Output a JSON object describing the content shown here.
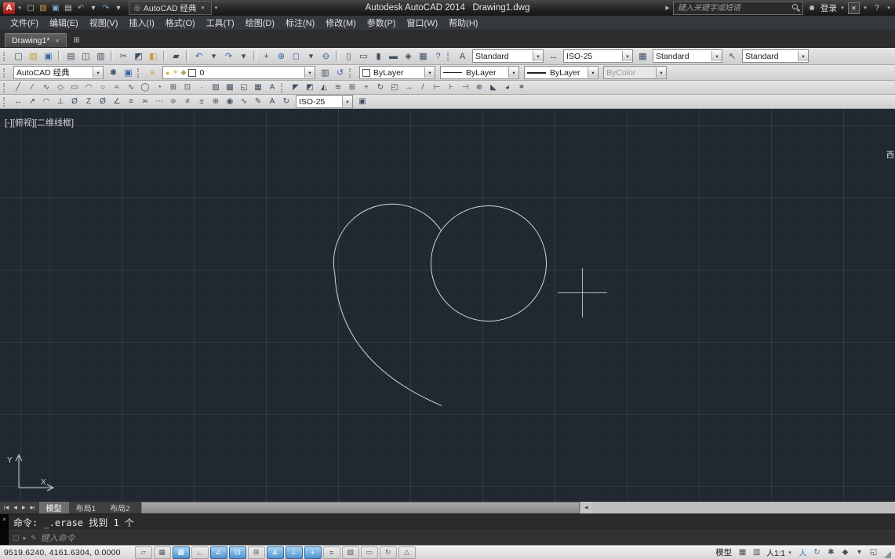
{
  "glyphs": {
    "caret": "▾",
    "play": "▶",
    "person": "☻",
    "exchange": "✕",
    "question": "?",
    "close": "×"
  },
  "colors": {
    "canvas_background": "#212830",
    "drawing_line": "#d6d9dc",
    "toggle_on_blue": "#4e93cf",
    "logo_red": "#9c150f"
  },
  "titlebar": {
    "logo_letter": "A",
    "qat": [
      {
        "name": "qat-new-icon",
        "glyph": "▢"
      },
      {
        "name": "qat-open-icon",
        "glyph": "▧",
        "color": "#c89a3c"
      },
      {
        "name": "qat-save-icon",
        "glyph": "▣",
        "color": "#7fa8d8"
      },
      {
        "name": "qat-plot-icon",
        "glyph": "▤"
      },
      {
        "name": "qat-undo-icon",
        "glyph": "↶",
        "color": "#7fa8d8"
      },
      {
        "name": "qat-undo-dropdown-icon",
        "glyph": "▾"
      },
      {
        "name": "qat-redo-icon",
        "glyph": "↷",
        "color": "#7fa8d8"
      },
      {
        "name": "qat-redo-dropdown-icon",
        "glyph": "▾"
      }
    ],
    "workspace_icon_glyph": "◎",
    "workspace_selector": "AutoCAD 经典",
    "app_title": "Autodesk AutoCAD 2014",
    "doc_title": "Drawing1.dwg",
    "search_placeholder": "键入关键字或短语",
    "signin_label": "登录"
  },
  "menubar": {
    "items": [
      "文件(F)",
      "编辑(E)",
      "视图(V)",
      "插入(I)",
      "格式(O)",
      "工具(T)",
      "绘图(D)",
      "标注(N)",
      "修改(M)",
      "参数(P)",
      "窗口(W)",
      "帮助(H)"
    ]
  },
  "filetabs": {
    "active": "Drawing1*",
    "new_tab_glyph": "⊞"
  },
  "toolbars": {
    "standard": [
      {
        "name": "new-icon",
        "glyph": "▢"
      },
      {
        "name": "open-icon",
        "glyph": "▧",
        "color": "#c89a3c"
      },
      {
        "name": "save-icon",
        "glyph": "▣",
        "color": "#3a62a8"
      },
      {
        "name": "toolbar-separator",
        "glyph": "",
        "type": "sep"
      },
      {
        "name": "plot-icon",
        "glyph": "▤"
      },
      {
        "name": "plot-preview-icon",
        "glyph": "◫"
      },
      {
        "name": "publish-icon",
        "glyph": "▥"
      },
      {
        "name": "toolbar-separator",
        "glyph": "",
        "type": "sep"
      },
      {
        "name": "cut-icon",
        "glyph": "✂"
      },
      {
        "name": "copy-icon",
        "glyph": "◩"
      },
      {
        "name": "paste-icon",
        "glyph": "◧",
        "color": "#c89a3c"
      },
      {
        "name": "toolbar-separator",
        "glyph": "",
        "type": "sep"
      },
      {
        "name": "match-properties-icon",
        "glyph": "▰"
      },
      {
        "name": "toolbar-separator",
        "glyph": "",
        "type": "sep"
      },
      {
        "name": "undo-icon",
        "glyph": "↶",
        "color": "#3a62a8"
      },
      {
        "name": "undo-dropdown-icon",
        "glyph": "▾"
      },
      {
        "name": "redo-icon",
        "glyph": "↷",
        "color": "#3a62a8"
      },
      {
        "name": "redo-dropdown-icon",
        "glyph": "▾"
      },
      {
        "name": "toolbar-separator",
        "glyph": "",
        "type": "sep"
      },
      {
        "name": "pan-icon",
        "glyph": "+"
      },
      {
        "name": "zoom-realtime-icon",
        "glyph": "⊕",
        "color": "#3a62a8"
      },
      {
        "name": "zoom-window-icon",
        "glyph": "◻",
        "color": "#3a62a8"
      },
      {
        "name": "zoom-dropdown-icon",
        "glyph": "▾"
      },
      {
        "name": "zoom-previous-icon",
        "glyph": "⊖",
        "color": "#3a62a8"
      },
      {
        "name": "toolbar-separator",
        "glyph": "",
        "type": "sep"
      },
      {
        "name": "properties-icon",
        "glyph": "▯"
      },
      {
        "name": "designcenter-icon",
        "glyph": "▭"
      },
      {
        "name": "tool-palettes-icon",
        "glyph": "▮"
      },
      {
        "name": "sheet-set-manager-icon",
        "glyph": "▬"
      },
      {
        "name": "markup-set-manager-icon",
        "glyph": "◈"
      },
      {
        "name": "quickcalc-icon",
        "glyph": "▦"
      },
      {
        "name": "help-icon",
        "glyph": "?",
        "color": "#3a62a8"
      }
    ],
    "text_style_icon": "A",
    "text_style": "Standard",
    "dim_style_icon": "↔",
    "dim_style": "ISO-25",
    "table_style_icon": "▦",
    "table_style": "Standard",
    "mleader_style_icon": "↖",
    "mleader_style": "Standard",
    "workspace_value": "AutoCAD 经典",
    "workspace_icons": [
      {
        "name": "gear-icon",
        "glyph": "✱"
      },
      {
        "name": "save-workspace-icon",
        "glyph": "▣",
        "color": "#3a62a8"
      }
    ],
    "layer_tools_left": [
      {
        "name": "layer-properties-manager-icon",
        "glyph": "≡",
        "color": "#c89a3c"
      }
    ],
    "layer_combo": {
      "on_glyph": "●",
      "freeze_glyph": "☀",
      "lock_glyph": "◆",
      "name": "0"
    },
    "layer_tools_right": [
      {
        "name": "layer-states-icon",
        "glyph": "▥"
      },
      {
        "name": "layer-previous-icon",
        "glyph": "↺",
        "color": "#3a62a8"
      }
    ],
    "color_value": "ByLayer",
    "linetype_value": "ByLayer",
    "lineweight_value": "ByLayer",
    "plotstyle_value": "ByColor",
    "draw": [
      {
        "name": "line-icon",
        "glyph": "╱"
      },
      {
        "name": "construction-line-icon",
        "glyph": "∕"
      },
      {
        "name": "polyline-icon",
        "glyph": "∿"
      },
      {
        "name": "polygon-icon",
        "glyph": "◇"
      },
      {
        "name": "rectangle-icon",
        "glyph": "▭"
      },
      {
        "name": "arc-icon",
        "glyph": "◠"
      },
      {
        "name": "circle-icon",
        "glyph": "○"
      },
      {
        "name": "revision-cloud-icon",
        "glyph": "≈"
      },
      {
        "name": "spline-icon",
        "glyph": "∿"
      },
      {
        "name": "ellipse-icon",
        "glyph": "◯"
      },
      {
        "name": "ellipse-arc-icon",
        "glyph": "◔"
      },
      {
        "name": "insert-block-icon",
        "glyph": "⊞"
      },
      {
        "name": "make-block-icon",
        "glyph": "⊡"
      },
      {
        "name": "point-icon",
        "glyph": "·"
      },
      {
        "name": "hatch-icon",
        "glyph": "▨"
      },
      {
        "name": "gradient-icon",
        "glyph": "▩"
      },
      {
        "name": "region-icon",
        "glyph": "◱"
      },
      {
        "name": "table-icon",
        "glyph": "▦"
      },
      {
        "name": "multiline-text-icon",
        "glyph": "A"
      }
    ],
    "modify": [
      {
        "name": "erase-icon",
        "glyph": "◤"
      },
      {
        "name": "copy-object-icon",
        "glyph": "◩"
      },
      {
        "name": "mirror-icon",
        "glyph": "◭"
      },
      {
        "name": "offset-icon",
        "glyph": "≋"
      },
      {
        "name": "array-icon",
        "glyph": "⊞"
      },
      {
        "name": "move-icon",
        "glyph": "+"
      },
      {
        "name": "rotate-icon",
        "glyph": "↻"
      },
      {
        "name": "scale-icon",
        "glyph": "◰"
      },
      {
        "name": "stretch-icon",
        "glyph": "→"
      },
      {
        "name": "trim-icon",
        "glyph": "/"
      },
      {
        "name": "extend-icon",
        "glyph": "⊢"
      },
      {
        "name": "break-at-point-icon",
        "glyph": "⊦"
      },
      {
        "name": "break-icon",
        "glyph": "⊣"
      },
      {
        "name": "join-icon",
        "glyph": "⊕"
      },
      {
        "name": "chamfer-icon",
        "glyph": "◣"
      },
      {
        "name": "fillet-icon",
        "glyph": "◕"
      },
      {
        "name": "explode-icon",
        "glyph": "✶"
      }
    ],
    "dimension": [
      {
        "name": "linear-dimension-icon",
        "glyph": "↔"
      },
      {
        "name": "aligned-dimension-icon",
        "glyph": "↗"
      },
      {
        "name": "arc-length-dimension-icon",
        "glyph": "◠"
      },
      {
        "name": "ordinate-dimension-icon",
        "glyph": "⊥"
      },
      {
        "name": "radius-dimension-icon",
        "glyph": "Ø"
      },
      {
        "name": "jogged-dimension-icon",
        "glyph": "Z"
      },
      {
        "name": "diameter-dimension-icon",
        "glyph": "Ø"
      },
      {
        "name": "angular-dimension-icon",
        "glyph": "∠"
      },
      {
        "name": "quick-dimension-icon",
        "glyph": "≡"
      },
      {
        "name": "baseline-dimension-icon",
        "glyph": "≍"
      },
      {
        "name": "continue-dimension-icon",
        "glyph": "⋯"
      },
      {
        "name": "dimension-space-icon",
        "glyph": "≑"
      },
      {
        "name": "dimension-break-icon",
        "glyph": "≠"
      },
      {
        "name": "tolerance-icon",
        "glyph": "±"
      },
      {
        "name": "center-mark-icon",
        "glyph": "⊕"
      },
      {
        "name": "inspection-icon",
        "glyph": "◉"
      },
      {
        "name": "jogged-linear-icon",
        "glyph": "∿"
      },
      {
        "name": "dimension-edit-icon",
        "glyph": "✎"
      },
      {
        "name": "dimension-text-edit-icon",
        "glyph": "A"
      },
      {
        "name": "dimension-update-icon",
        "glyph": "↻"
      }
    ],
    "dim_style_combo": "ISO-25",
    "dim_style_button_glyph": "▣"
  },
  "canvas": {
    "viewport_label": "[-][俯视][二维线框]",
    "compass_label": "西",
    "ucs_x": "X",
    "ucs_y": "Y"
  },
  "layout_row": {
    "nav": [
      {
        "name": "first-tab-button",
        "glyph": "|◀"
      },
      {
        "name": "prev-tab-button",
        "glyph": "◀"
      },
      {
        "name": "next-tab-button",
        "glyph": "▶"
      },
      {
        "name": "last-tab-button",
        "glyph": "▶|"
      }
    ],
    "tabs": [
      {
        "name": "tab-model",
        "label": "模型",
        "state": "active"
      },
      {
        "name": "tab-layout1",
        "label": "布局1",
        "state": "inactive"
      },
      {
        "name": "tab-layout2",
        "label": "布局2",
        "state": "inactive"
      }
    ],
    "scroll_left_glyph": "◀"
  },
  "command": {
    "history": "命令: _.erase 找到 1 个",
    "box_glyph": "▢",
    "options_glyph": "▸",
    "pencil_glyph": "✎",
    "prompt_placeholder": "键入命令"
  },
  "statusbar": {
    "coords": "9519.6240, 4161.6304, 0.0000",
    "toggles": [
      {
        "name": "infer-constraints-toggle",
        "glyph": "▱",
        "state": "off"
      },
      {
        "name": "snap-mode-toggle",
        "glyph": "▦",
        "state": "off"
      },
      {
        "name": "grid-display-toggle",
        "glyph": "▦",
        "state": "on"
      },
      {
        "name": "ortho-mode-toggle",
        "glyph": "∟",
        "state": "off"
      },
      {
        "name": "polar-tracking-toggle",
        "glyph": "∠",
        "state": "on"
      },
      {
        "name": "object-snap-toggle",
        "glyph": "⊡",
        "state": "on"
      },
      {
        "name": "object-snap-3d-toggle",
        "glyph": "⊞",
        "state": "off"
      },
      {
        "name": "object-snap-tracking-toggle",
        "glyph": "∡",
        "state": "on"
      },
      {
        "name": "dynamic-ucs-toggle",
        "glyph": "⊥",
        "state": "on"
      },
      {
        "name": "dynamic-input-toggle",
        "glyph": "+",
        "state": "on"
      },
      {
        "name": "lineweight-display-toggle",
        "glyph": "≡",
        "state": "off"
      },
      {
        "name": "transparency-toggle",
        "glyph": "▨",
        "state": "off"
      },
      {
        "name": "quick-properties-toggle",
        "glyph": "▭",
        "state": "off"
      },
      {
        "name": "selection-cycling-toggle",
        "glyph": "↻",
        "state": "off"
      },
      {
        "name": "annotation-monitor-toggle",
        "glyph": "△",
        "state": "off"
      }
    ],
    "model_label": "模型",
    "quickview": [
      {
        "name": "quick-view-layouts-icon",
        "glyph": "▦"
      },
      {
        "name": "quick-view-drawings-icon",
        "glyph": "▥"
      }
    ],
    "annotation_scale": "人1:1",
    "right_icons": [
      {
        "name": "annotation-visibility-icon",
        "glyph": "人",
        "color": "#3a72b8"
      },
      {
        "name": "autoscale-icon",
        "glyph": "↻",
        "color": "#3a72b8"
      },
      {
        "name": "workspace-switching-icon",
        "glyph": "✱"
      },
      {
        "name": "toolbar-lock-icon",
        "glyph": "◆"
      },
      {
        "name": "statusbar-menu-icon",
        "glyph": "▾"
      },
      {
        "name": "cleanscreen-icon",
        "glyph": "◱"
      }
    ]
  }
}
